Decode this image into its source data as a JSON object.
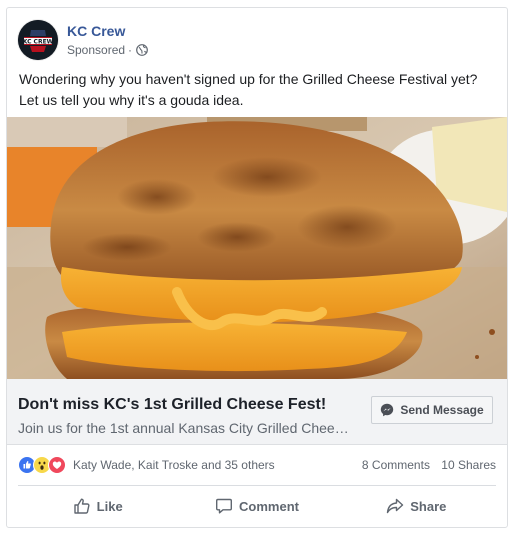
{
  "post": {
    "page_name": "KC Crew",
    "sponsored_label": "Sponsored",
    "separator": "·",
    "audience_icon": "globe-icon",
    "avatar_text": "KC CREW",
    "text": "Wondering why you haven't signed up for the Grilled Cheese Festival yet? Let us tell you why it's a gouda idea."
  },
  "link": {
    "title": "Don't miss KC's 1st Grilled Cheese Fest!",
    "description": "Join us for the 1st annual Kansas City Grilled Chee…",
    "button_label": "Send Message",
    "button_icon": "messenger-icon"
  },
  "reactions": {
    "icons": [
      "like-icon",
      "wow-icon",
      "love-icon"
    ],
    "names": "Katy Wade, Kait Troske and 35 others",
    "comments": "8 Comments",
    "shares": "10 Shares"
  },
  "actions": {
    "like": "Like",
    "comment": "Comment",
    "share": "Share"
  },
  "colors": {
    "link_blue": "#385898",
    "like_blue": "#3b74f0",
    "love_red": "#f0485c",
    "wow_yellow": "#f7d84a"
  }
}
